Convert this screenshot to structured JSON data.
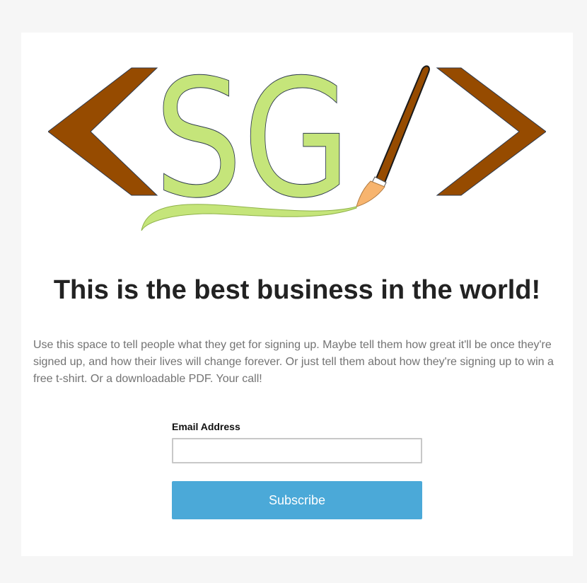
{
  "logo": {
    "text": "SG",
    "fill_color": "#c5e57a",
    "bracket_color": "#964b00",
    "brush_tip_color": "#f7b46e"
  },
  "headline": "This is the best business in the world!",
  "intro": "Use this space to tell people what they get for signing up. Maybe tell them how great it'll be once they're signed up, and how their lives will change forever. Or just tell them about how they're signing up to win a free t-shirt. Or a downloadable PDF. Your call!",
  "form": {
    "email_label": "Email Address",
    "email_value": "",
    "email_placeholder": "",
    "subscribe_label": "Subscribe"
  },
  "colors": {
    "page_background": "#f6f6f6",
    "card_background": "#ffffff",
    "button": "#4ba9d8"
  }
}
